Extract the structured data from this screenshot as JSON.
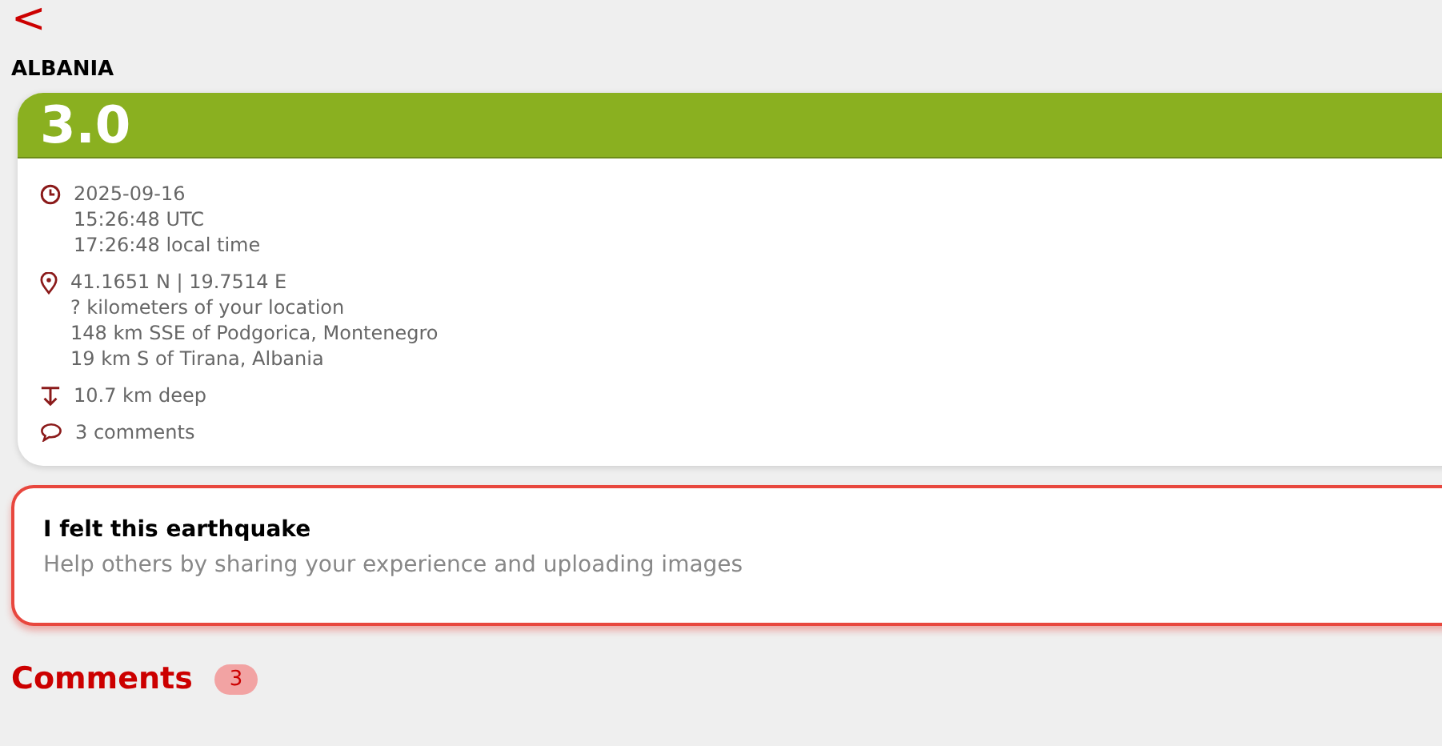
{
  "back": "<",
  "region": "ALBANIA",
  "quake": {
    "magnitude": "3.0",
    "details": [
      {
        "kind": "time",
        "lines": [
          "2025-09-16",
          "15:26:48 UTC",
          "17:26:48 local time"
        ]
      },
      {
        "kind": "location",
        "lines": [
          "41.1651 N | 19.7514 E",
          "? kilometers of your location",
          "148 km SSE of Podgorica, Montenegro",
          "19 km S of Tirana, Albania"
        ]
      },
      {
        "kind": "depth",
        "lines": [
          "10.7 km deep"
        ]
      },
      {
        "kind": "comments",
        "lines": [
          "3 comments"
        ]
      }
    ]
  },
  "felt": {
    "title": "I felt this earthquake",
    "text": "Help others by sharing your experience and uploading images"
  },
  "comments": {
    "title": "Comments",
    "count": "3"
  }
}
